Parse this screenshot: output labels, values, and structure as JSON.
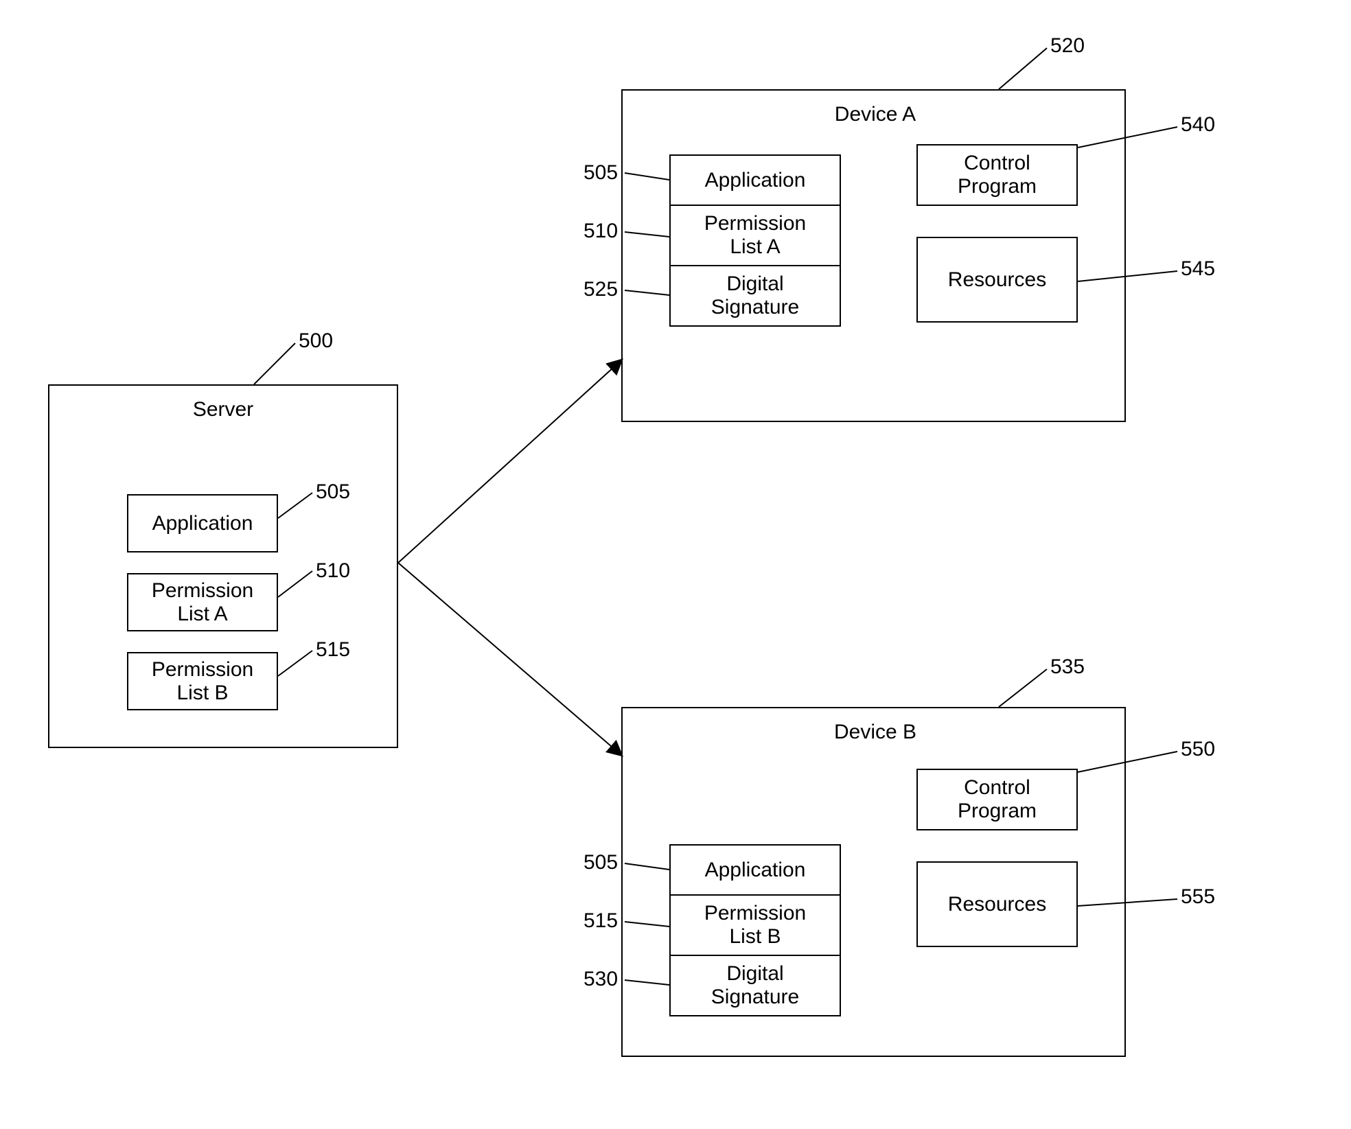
{
  "refs": {
    "server": "500",
    "application": "505",
    "permListA": "510",
    "permListB": "515",
    "deviceA": "520",
    "digSigA": "525",
    "digSigB": "530",
    "deviceB": "535",
    "controlA": "540",
    "resourcesA": "545",
    "controlB": "550",
    "resourcesB": "555"
  },
  "titles": {
    "server": "Server",
    "deviceA": "Device A",
    "deviceB": "Device B"
  },
  "blocks": {
    "application": "Application",
    "permListA": "Permission\nList A",
    "permListB": "Permission\nList B",
    "digitalSignature": "Digital\nSignature",
    "controlProgram": "Control\nProgram",
    "resources": "Resources"
  }
}
